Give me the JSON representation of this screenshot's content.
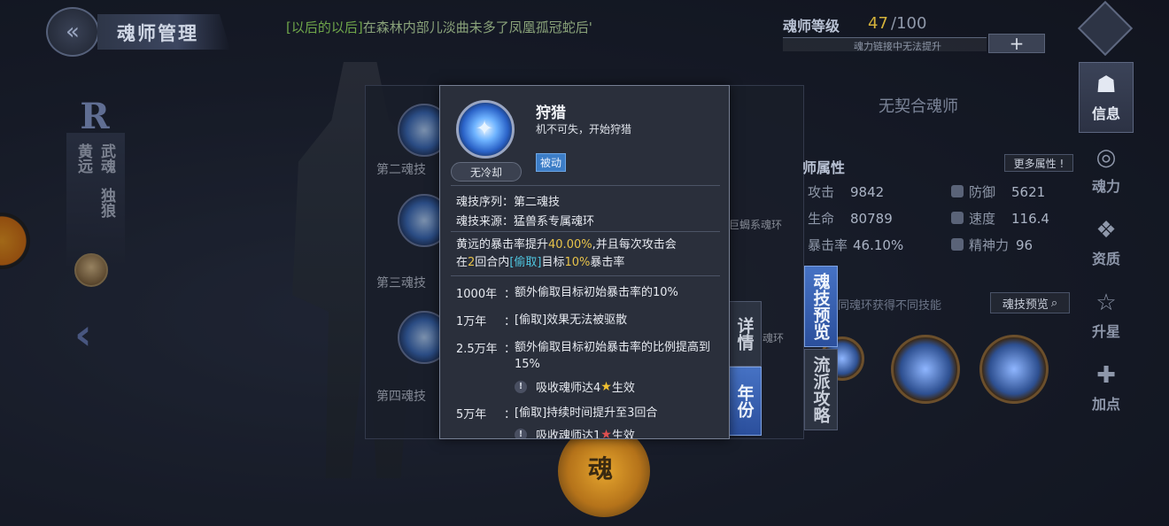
{
  "header": {
    "title": "魂师管理",
    "marquee_prefix": "[以后的以后]",
    "marquee_text": "在森林内部儿淡曲未多了凤凰孤冠蛇后'",
    "level_label": "魂师等级",
    "level_current": "47",
    "level_max": "/100",
    "level_note": "魂力链接中无法提升",
    "plus": "+"
  },
  "left": {
    "rank": "R",
    "char_name": "黄远",
    "wuhun_label": "武魂",
    "wuhun_name": "独狼",
    "prev_arrow": "‹"
  },
  "list": {
    "items": [
      "第二魂技",
      "第三魂技",
      "第四魂技"
    ],
    "ring_text_1": "巨蝎系魂环",
    "ring_text_2": "魂环"
  },
  "stats": {
    "contract": "无契合魂师",
    "attr_title": "师属性",
    "more_attr": "更多属性 !",
    "rows": [
      {
        "label": "攻击",
        "value": "9842"
      },
      {
        "label": "防御",
        "value": "5621"
      },
      {
        "label": "生命",
        "value": "80789"
      },
      {
        "label": "速度",
        "value": "116.4"
      },
      {
        "label": "暴击率",
        "value": "46.10%"
      },
      {
        "label": "精神力",
        "value": "96"
      }
    ],
    "ring_hint": "同魂环获得不同技能",
    "preview_btn": "魂技预览"
  },
  "tabs": {
    "detail": "详情",
    "year": "年份",
    "preview": "魂技预览",
    "school": "流派攻略"
  },
  "gold_char": "魂",
  "nav": [
    {
      "icon": "info-icon",
      "glyph": "☗",
      "label": "信息"
    },
    {
      "icon": "soul-power-icon",
      "glyph": "◎",
      "label": "魂力"
    },
    {
      "icon": "talent-icon",
      "glyph": "❖",
      "label": "资质"
    },
    {
      "icon": "star-up-icon",
      "glyph": "☆",
      "label": "升星"
    },
    {
      "icon": "add-point-icon",
      "glyph": "✚",
      "label": "加点"
    }
  ],
  "tooltip": {
    "name": "狩猎",
    "desc": "机不可失，开始狩猎",
    "cooldown": "无冷却",
    "badge": "被动",
    "order_label": "魂技序列：",
    "order_value": "第二魂技",
    "source_label": "魂技来源：",
    "source_value": "猛兽系专属魂环",
    "effect": {
      "p1": "黄远的暴击率提升",
      "pct": "40.00%",
      "p2": ",并且每次攻击会",
      "p3": "在",
      "rounds": "2",
      "p4": "回合内",
      "tag": "[偷取]",
      "p5": "目标",
      "pct2": "10%",
      "p6": "暴击率"
    },
    "years": [
      {
        "key": "1000年",
        "value": "额外偷取目标初始暴击率的10%"
      },
      {
        "key": "1万年",
        "value": "[偷取]效果无法被驱散"
      },
      {
        "key": "2.5万年",
        "value": "额外偷取目标初始暴击率的比例提高到15%"
      },
      {
        "key": "5万年",
        "value": "[偷取]持续时间提升至3回合"
      }
    ],
    "cond1_pre": "吸收魂师达4",
    "cond1_post": "生效",
    "cond2_pre": "吸收魂师达1",
    "cond2_post": "生效",
    "warn": "!",
    "colon": "："
  }
}
